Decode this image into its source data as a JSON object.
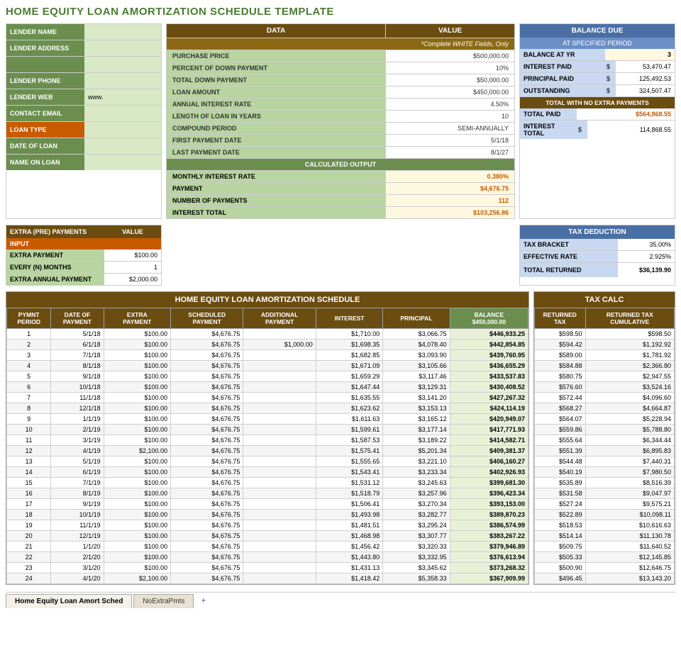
{
  "title": "HOME EQUITY LOAN AMORTIZATION SCHEDULE TEMPLATE",
  "lender": {
    "fields": [
      {
        "label": "LENDER NAME",
        "value": "",
        "label_class": ""
      },
      {
        "label": "LENDER ADDRESS",
        "value": "",
        "label_class": ""
      },
      {
        "label": "",
        "value": "",
        "label_class": ""
      },
      {
        "label": "LENDER PHONE",
        "value": "",
        "label_class": ""
      },
      {
        "label": "LENDER WEB",
        "value": "www.",
        "label_class": ""
      },
      {
        "label": "CONTACT EMAIL",
        "value": "",
        "label_class": ""
      },
      {
        "label": "LOAN TYPE",
        "value": "",
        "label_class": "orange"
      },
      {
        "label": "DATE OF LOAN",
        "value": "",
        "label_class": ""
      },
      {
        "label": "NAME ON LOAN",
        "value": "",
        "label_class": ""
      }
    ]
  },
  "data_table": {
    "headers": [
      "DATA",
      "VALUE"
    ],
    "subtitle": "*Complete WHITE Fields, Only",
    "rows": [
      {
        "label": "PURCHASE PRICE",
        "value": "$500,000.00"
      },
      {
        "label": "PERCENT OF DOWN PAYMENT",
        "value": "10%"
      },
      {
        "label": "TOTAL DOWN PAYMENT",
        "value": "$50,000.00"
      },
      {
        "label": "LOAN AMOUNT",
        "value": "$450,000.00"
      },
      {
        "label": "ANNUAL INTEREST RATE",
        "value": "4.50%"
      },
      {
        "label": "LENGTH OF LOAN IN YEARS",
        "value": "10"
      },
      {
        "label": "COMPOUND PERIOD",
        "value": "SEMI-ANNUALLY"
      },
      {
        "label": "FIRST PAYMENT DATE",
        "value": "5/1/18"
      },
      {
        "label": "LAST PAYMENT DATE",
        "value": "8/1/27"
      }
    ],
    "calc_header": "CALCULATED OUTPUT",
    "calc_rows": [
      {
        "label": "MONTHLY INTEREST RATE",
        "value": "0.380%"
      },
      {
        "label": "PAYMENT",
        "value": "$4,676.75"
      },
      {
        "label": "NUMBER OF PAYMENTS",
        "value": "112"
      },
      {
        "label": "INTEREST TOTAL",
        "value": "$103,256.86"
      }
    ]
  },
  "balance_due": {
    "title": "BALANCE DUE",
    "subtitle": "AT SPECIFIED PERIOD",
    "balance_at_yr_label": "BALANCE AT YR",
    "balance_at_yr_val": "3",
    "rows": [
      {
        "label": "INTEREST PAID",
        "dollar": "$",
        "value": "53,470.47"
      },
      {
        "label": "PRINCIPAL PAID",
        "dollar": "$",
        "value": "125,492.53"
      },
      {
        "label": "OUTSTANDING",
        "dollar": "$",
        "value": "324,507.47"
      }
    ],
    "no_extra_header": "TOTAL WITH NO EXTRA PAYMENTS",
    "total_paid_label": "TOTAL PAID",
    "total_paid_val": "$564,868.55",
    "interest_total_label": "INTEREST TOTAL",
    "interest_total_dollar": "$",
    "interest_total_val": "114,868.55"
  },
  "extra_payments": {
    "header1": "EXTRA (PRE) PAYMENTS",
    "header2": "VALUE",
    "input_label": "INPUT",
    "rows": [
      {
        "label": "EXTRA PAYMENT",
        "value": "$100.00"
      },
      {
        "label": "EVERY (N) MONTHS",
        "value": "1"
      },
      {
        "label": "EXTRA ANNUAL PAYMENT",
        "value": "$2,000.00"
      }
    ]
  },
  "tax_deduction": {
    "title": "TAX DEDUCTION",
    "rows": [
      {
        "label": "TAX BRACKET",
        "value": "35.00%"
      },
      {
        "label": "EFFECTIVE RATE",
        "value": "2.925%"
      }
    ],
    "total_label": "TOTAL RETURNED",
    "total_val": "$36,139.90"
  },
  "amort_table": {
    "main_header": "HOME EQUITY LOAN AMORTIZATION SCHEDULE",
    "tax_calc_header": "TAX CALC",
    "col_headers": [
      "PYMNT PERIOD",
      "DATE OF PAYMENT",
      "EXTRA PAYMENT",
      "SCHEDULED PAYMENT",
      "ADDITIONAL PAYMENT",
      "INTEREST",
      "PRINCIPAL",
      "BALANCE $450,000.00"
    ],
    "tax_headers": [
      "RETURNED TAX",
      "RETURNED TAX CUMULATIVE"
    ],
    "rows": [
      {
        "period": "1",
        "date": "5/1/18",
        "extra": "$100.00",
        "scheduled": "$4,676.75",
        "additional": "",
        "interest": "$1,710.00",
        "principal": "$3,066.75",
        "balance": "$446,933.25",
        "ret_tax": "$598.50",
        "ret_cum": "$598.50"
      },
      {
        "period": "2",
        "date": "6/1/18",
        "extra": "$100.00",
        "scheduled": "$4,676.75",
        "additional": "$1,000.00",
        "interest": "$1,698.35",
        "principal": "$4,078.40",
        "balance": "$442,854.85",
        "ret_tax": "$594.42",
        "ret_cum": "$1,192.92"
      },
      {
        "period": "3",
        "date": "7/1/18",
        "extra": "$100.00",
        "scheduled": "$4,676.75",
        "additional": "",
        "interest": "$1,682.85",
        "principal": "$3,093.90",
        "balance": "$439,760.95",
        "ret_tax": "$589.00",
        "ret_cum": "$1,781.92"
      },
      {
        "period": "4",
        "date": "8/1/18",
        "extra": "$100.00",
        "scheduled": "$4,676.75",
        "additional": "",
        "interest": "$1,671.09",
        "principal": "$3,105.66",
        "balance": "$436,655.29",
        "ret_tax": "$584.88",
        "ret_cum": "$2,366.80"
      },
      {
        "period": "5",
        "date": "9/1/18",
        "extra": "$100.00",
        "scheduled": "$4,676.75",
        "additional": "",
        "interest": "$1,659.29",
        "principal": "$3,117.46",
        "balance": "$433,537.83",
        "ret_tax": "$580.75",
        "ret_cum": "$2,947.55"
      },
      {
        "period": "6",
        "date": "10/1/18",
        "extra": "$100.00",
        "scheduled": "$4,676.75",
        "additional": "",
        "interest": "$1,647.44",
        "principal": "$3,129.31",
        "balance": "$430,408.52",
        "ret_tax": "$576.60",
        "ret_cum": "$3,524.16"
      },
      {
        "period": "7",
        "date": "11/1/18",
        "extra": "$100.00",
        "scheduled": "$4,676.75",
        "additional": "",
        "interest": "$1,635.55",
        "principal": "$3,141.20",
        "balance": "$427,267.32",
        "ret_tax": "$572.44",
        "ret_cum": "$4,096.60"
      },
      {
        "period": "8",
        "date": "12/1/18",
        "extra": "$100.00",
        "scheduled": "$4,676.75",
        "additional": "",
        "interest": "$1,623.62",
        "principal": "$3,153.13",
        "balance": "$424,114.19",
        "ret_tax": "$568.27",
        "ret_cum": "$4,664.87"
      },
      {
        "period": "9",
        "date": "1/1/19",
        "extra": "$100.00",
        "scheduled": "$4,676.75",
        "additional": "",
        "interest": "$1,611.63",
        "principal": "$3,165.12",
        "balance": "$420,949.07",
        "ret_tax": "$564.07",
        "ret_cum": "$5,228.94"
      },
      {
        "period": "10",
        "date": "2/1/19",
        "extra": "$100.00",
        "scheduled": "$4,676.75",
        "additional": "",
        "interest": "$1,599.61",
        "principal": "$3,177.14",
        "balance": "$417,771.93",
        "ret_tax": "$559.86",
        "ret_cum": "$5,788.80"
      },
      {
        "period": "11",
        "date": "3/1/19",
        "extra": "$100.00",
        "scheduled": "$4,676.75",
        "additional": "",
        "interest": "$1,587.53",
        "principal": "$3,189.22",
        "balance": "$414,582.71",
        "ret_tax": "$555.64",
        "ret_cum": "$6,344.44"
      },
      {
        "period": "12",
        "date": "4/1/19",
        "extra": "$2,100.00",
        "scheduled": "$4,676.75",
        "additional": "",
        "interest": "$1,575.41",
        "principal": "$5,201.34",
        "balance": "$409,381.37",
        "ret_tax": "$551.39",
        "ret_cum": "$6,895.83"
      },
      {
        "period": "13",
        "date": "5/1/19",
        "extra": "$100.00",
        "scheduled": "$4,676.75",
        "additional": "",
        "interest": "$1,555.65",
        "principal": "$3,221.10",
        "balance": "$406,160.27",
        "ret_tax": "$544.48",
        "ret_cum": "$7,440.31"
      },
      {
        "period": "14",
        "date": "6/1/19",
        "extra": "$100.00",
        "scheduled": "$4,676.75",
        "additional": "",
        "interest": "$1,543.41",
        "principal": "$3,233.34",
        "balance": "$402,926.93",
        "ret_tax": "$540.19",
        "ret_cum": "$7,980.50"
      },
      {
        "period": "15",
        "date": "7/1/19",
        "extra": "$100.00",
        "scheduled": "$4,676.75",
        "additional": "",
        "interest": "$1,531.12",
        "principal": "$3,245.63",
        "balance": "$399,681.30",
        "ret_tax": "$535.89",
        "ret_cum": "$8,516.39"
      },
      {
        "period": "16",
        "date": "8/1/19",
        "extra": "$100.00",
        "scheduled": "$4,676.75",
        "additional": "",
        "interest": "$1,518.79",
        "principal": "$3,257.96",
        "balance": "$396,423.34",
        "ret_tax": "$531.58",
        "ret_cum": "$9,047.97"
      },
      {
        "period": "17",
        "date": "9/1/19",
        "extra": "$100.00",
        "scheduled": "$4,676.75",
        "additional": "",
        "interest": "$1,506.41",
        "principal": "$3,270.34",
        "balance": "$393,153.00",
        "ret_tax": "$527.24",
        "ret_cum": "$9,575.21"
      },
      {
        "period": "18",
        "date": "10/1/19",
        "extra": "$100.00",
        "scheduled": "$4,676.75",
        "additional": "",
        "interest": "$1,493.98",
        "principal": "$3,282.77",
        "balance": "$389,870.23",
        "ret_tax": "$522.89",
        "ret_cum": "$10,098.11"
      },
      {
        "period": "19",
        "date": "11/1/19",
        "extra": "$100.00",
        "scheduled": "$4,676.75",
        "additional": "",
        "interest": "$1,481.51",
        "principal": "$3,295.24",
        "balance": "$386,574.99",
        "ret_tax": "$518.53",
        "ret_cum": "$10,616.63"
      },
      {
        "period": "20",
        "date": "12/1/19",
        "extra": "$100.00",
        "scheduled": "$4,676.75",
        "additional": "",
        "interest": "$1,468.98",
        "principal": "$3,307.77",
        "balance": "$383,267.22",
        "ret_tax": "$514.14",
        "ret_cum": "$11,130.78"
      },
      {
        "period": "21",
        "date": "1/1/20",
        "extra": "$100.00",
        "scheduled": "$4,676.75",
        "additional": "",
        "interest": "$1,456.42",
        "principal": "$3,320.33",
        "balance": "$379,946.89",
        "ret_tax": "$509.75",
        "ret_cum": "$11,640.52"
      },
      {
        "period": "22",
        "date": "2/1/20",
        "extra": "$100.00",
        "scheduled": "$4,676.75",
        "additional": "",
        "interest": "$1,443.80",
        "principal": "$3,332.95",
        "balance": "$376,613.94",
        "ret_tax": "$505.33",
        "ret_cum": "$12,145.85"
      },
      {
        "period": "23",
        "date": "3/1/20",
        "extra": "$100.00",
        "scheduled": "$4,676.75",
        "additional": "",
        "interest": "$1,431.13",
        "principal": "$3,345.62",
        "balance": "$373,268.32",
        "ret_tax": "$500.90",
        "ret_cum": "$12,646.75"
      },
      {
        "period": "24",
        "date": "4/1/20",
        "extra": "$2,100.00",
        "scheduled": "$4,676.75",
        "additional": "",
        "interest": "$1,418.42",
        "principal": "$5,358.33",
        "balance": "$367,909.99",
        "ret_tax": "$496.45",
        "ret_cum": "$13,143.20"
      }
    ]
  },
  "tabs": [
    {
      "label": "Home Equity Loan Amort Sched",
      "active": true
    },
    {
      "label": "NoExtraPmts",
      "active": false
    }
  ],
  "tab_add": "+"
}
